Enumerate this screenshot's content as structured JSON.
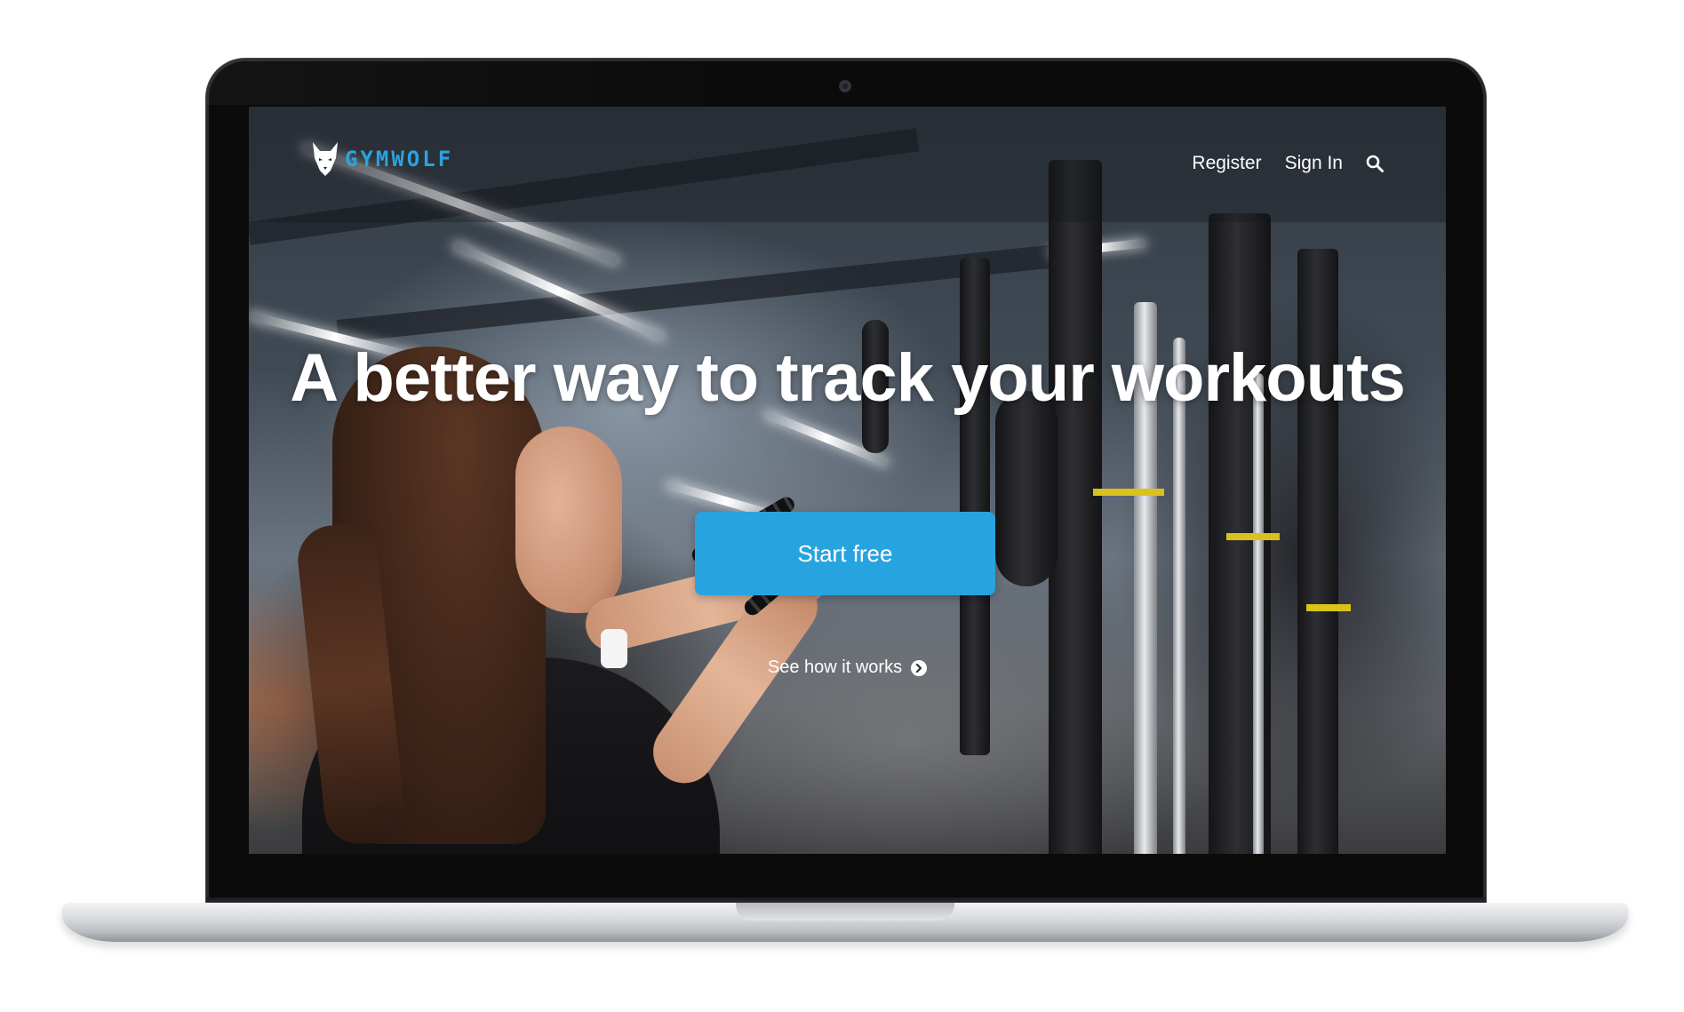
{
  "brand": {
    "name": "GYMWOLF",
    "accent_color": "#2ba3dd",
    "logo_icon": "wolf-head-icon"
  },
  "nav": {
    "register_label": "Register",
    "signin_label": "Sign In",
    "search_icon": "search-icon"
  },
  "hero": {
    "title": "A better way to track your workouts",
    "cta_label": "Start free",
    "cta_color": "#27a4e0",
    "secondary_link_label": "See how it works",
    "secondary_link_icon": "chevron-right-circle-icon"
  }
}
